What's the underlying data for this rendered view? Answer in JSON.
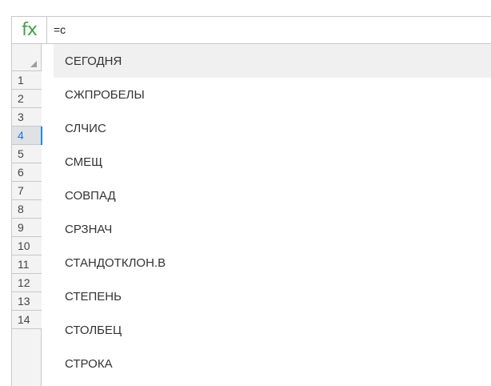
{
  "formula_bar": {
    "fx_label": "fx",
    "value": "=с"
  },
  "row_headers": [
    "1",
    "2",
    "3",
    "4",
    "5",
    "6",
    "7",
    "8",
    "9",
    "10",
    "11",
    "12",
    "13",
    "14"
  ],
  "active_row": "4",
  "autocomplete": {
    "selected_index": 0,
    "items": [
      "СЕГОДНЯ",
      "СЖПРОБЕЛЫ",
      "СЛЧИС",
      "СМЕЩ",
      "СОВПАД",
      "СРЗНАЧ",
      "СТАНДОТКЛОН.В",
      "СТЕПЕНЬ",
      "СТОЛБЕЦ",
      "СТРОКА"
    ]
  },
  "colors": {
    "fx_icon": "#43a047",
    "active_row_indicator": "#1e88e5"
  }
}
